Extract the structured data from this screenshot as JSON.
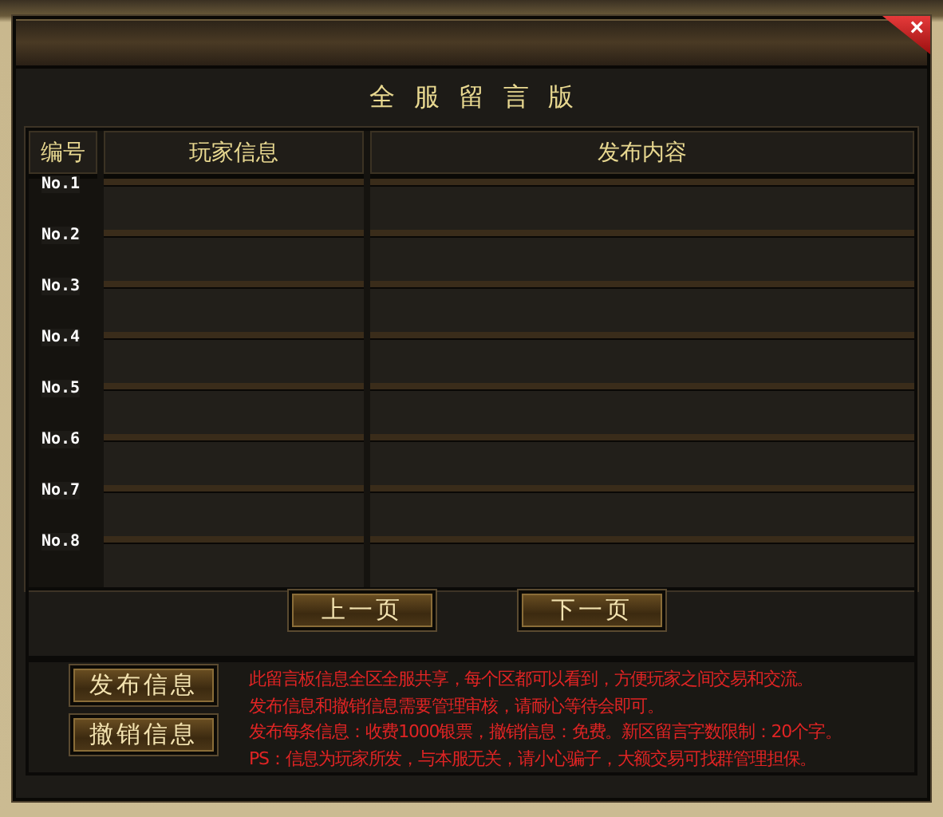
{
  "window": {
    "title": "全服留言版",
    "close": "×"
  },
  "table": {
    "columns": [
      "编号",
      "玩家信息",
      "发布内容"
    ],
    "rows": [
      {
        "number": "No.1"
      },
      {
        "number": "No.2"
      },
      {
        "number": "No.3"
      },
      {
        "number": "No.4"
      },
      {
        "number": "No.5"
      },
      {
        "number": "No.6"
      },
      {
        "number": "No.7"
      },
      {
        "number": "No.8"
      }
    ]
  },
  "pager": [
    "上一页",
    "下一页"
  ],
  "actions": [
    "发布信息",
    "撤销信息"
  ],
  "notice": [
    "此留言板信息全区全服共享，每个区都可以看到，方便玩家之间交易和交流。",
    "发布信息和撤销信息需要管理审核，请耐心等待会即可。",
    "发布每条信息：收费1000银票，撤销信息：免费。新区留言字数限制：20个字。",
    "PS：信息为玩家所发，与本服无关，请小心骗子，大额交易可找群管理担保。"
  ]
}
